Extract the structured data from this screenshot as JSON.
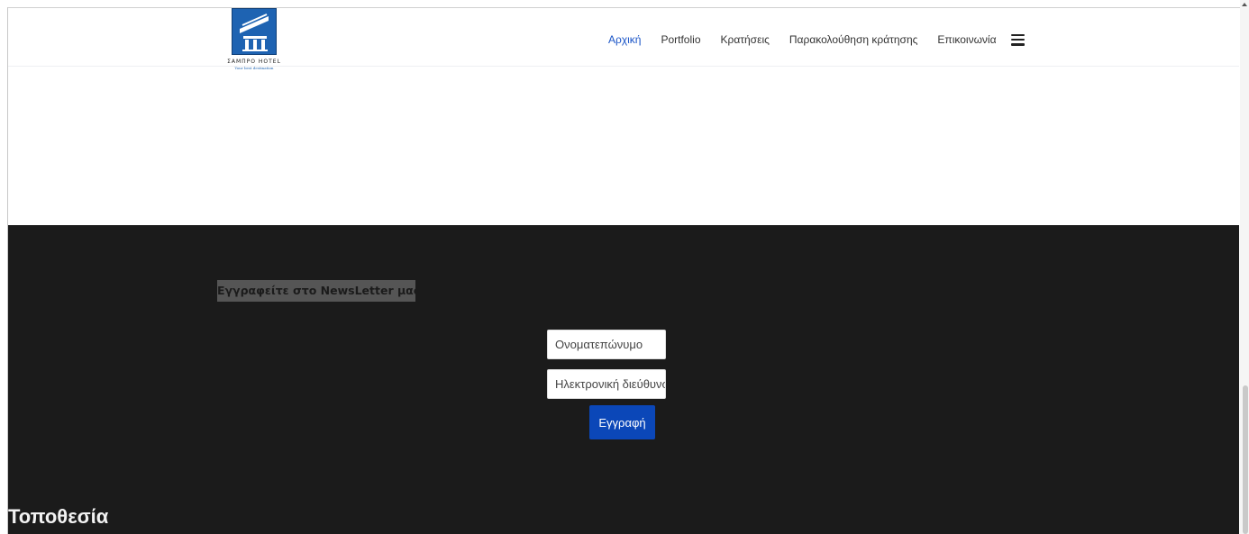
{
  "header": {
    "logo": {
      "name": "ΣΑΜΠΡΟ HOTEL",
      "tagline": "Your best destination",
      "icon": "hotel-building-logo-icon"
    },
    "nav": [
      {
        "label": "Αρχική",
        "active": true
      },
      {
        "label": "Portfolio",
        "active": false
      },
      {
        "label": "Κρατήσεις",
        "active": false
      },
      {
        "label": "Παρακολούθηση κράτησης",
        "active": false
      },
      {
        "label": "Επικοινωνία",
        "active": false
      }
    ],
    "menu_icon": "hamburger-menu-icon"
  },
  "newsletter": {
    "title": "Εγγραφείτε στο NewsLetter μας",
    "name_placeholder": "Ονοματεπώνυμο",
    "email_placeholder": "Ηλεκτρονική διεύθυνση",
    "submit_label": "Εγγραφή"
  },
  "location": {
    "title": "Τοποθεσία"
  },
  "colors": {
    "dark_section": "#1b1b1b",
    "accent": "#0b47b8",
    "active_nav": "#1a54c7"
  }
}
